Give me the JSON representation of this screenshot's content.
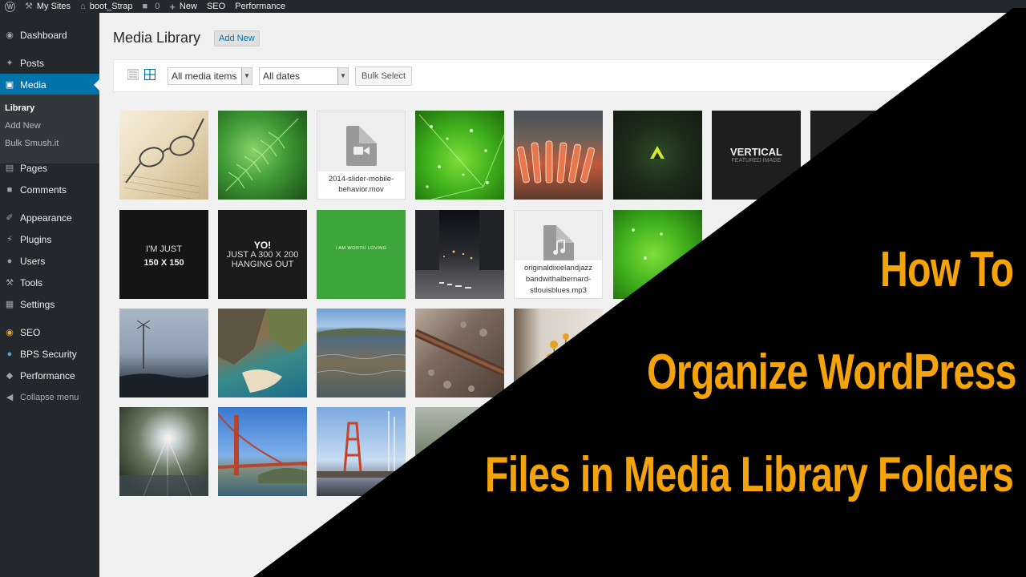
{
  "adminbar": {
    "my_sites": "My Sites",
    "site_name": "boot_Strap",
    "comments_count": "0",
    "new_label": "New",
    "seo_label": "SEO",
    "performance_label": "Performance"
  },
  "sidebar": {
    "items": [
      {
        "label": "Dashboard",
        "icon": "dashboard-icon"
      },
      {
        "label": "Posts",
        "icon": "pin-icon"
      },
      {
        "label": "Media",
        "icon": "media-icon"
      },
      {
        "label": "Pages",
        "icon": "pages-icon"
      },
      {
        "label": "Comments",
        "icon": "comment-icon"
      },
      {
        "label": "Appearance",
        "icon": "brush-icon"
      },
      {
        "label": "Plugins",
        "icon": "plug-icon"
      },
      {
        "label": "Users",
        "icon": "user-icon"
      },
      {
        "label": "Tools",
        "icon": "wrench-icon"
      },
      {
        "label": "Settings",
        "icon": "settings-icon"
      },
      {
        "label": "SEO",
        "icon": "seo-icon"
      },
      {
        "label": "BPS Security",
        "icon": "shield-icon"
      },
      {
        "label": "Performance",
        "icon": "performance-icon"
      },
      {
        "label": "Collapse menu",
        "icon": "collapse-icon"
      }
    ],
    "submenu": [
      "Library",
      "Add New",
      "Bulk Smush.it"
    ]
  },
  "page": {
    "title": "Media Library",
    "add_new": "Add New"
  },
  "toolbar": {
    "filter_type": "All media items",
    "filter_date": "All dates",
    "bulk_select": "Bulk Select"
  },
  "tiles": {
    "mov_file": "2014-slider-mobile-behavior.mov",
    "mp3_file": "originaldixielandjazz bandwithalbernard-stlouisblues.mp3",
    "vertical_title": "VERTICAL",
    "vertical_sub": "FEATURED IMAGE",
    "im_just": "I'M JUST",
    "size_150": "150 X 150",
    "yo": "YO!",
    "just_300": "JUST A 300 X 200",
    "hanging": "HANGING OUT",
    "worth": "I AM WORTH LOVING"
  },
  "headline": {
    "line1": "How To",
    "line2": "Organize WordPress",
    "line3": "Files in Media Library Folders"
  },
  "colors": {
    "accent_blue": "#0073aa",
    "headline_orange": "#f5a30b",
    "sidebar_dark": "#23282d"
  }
}
